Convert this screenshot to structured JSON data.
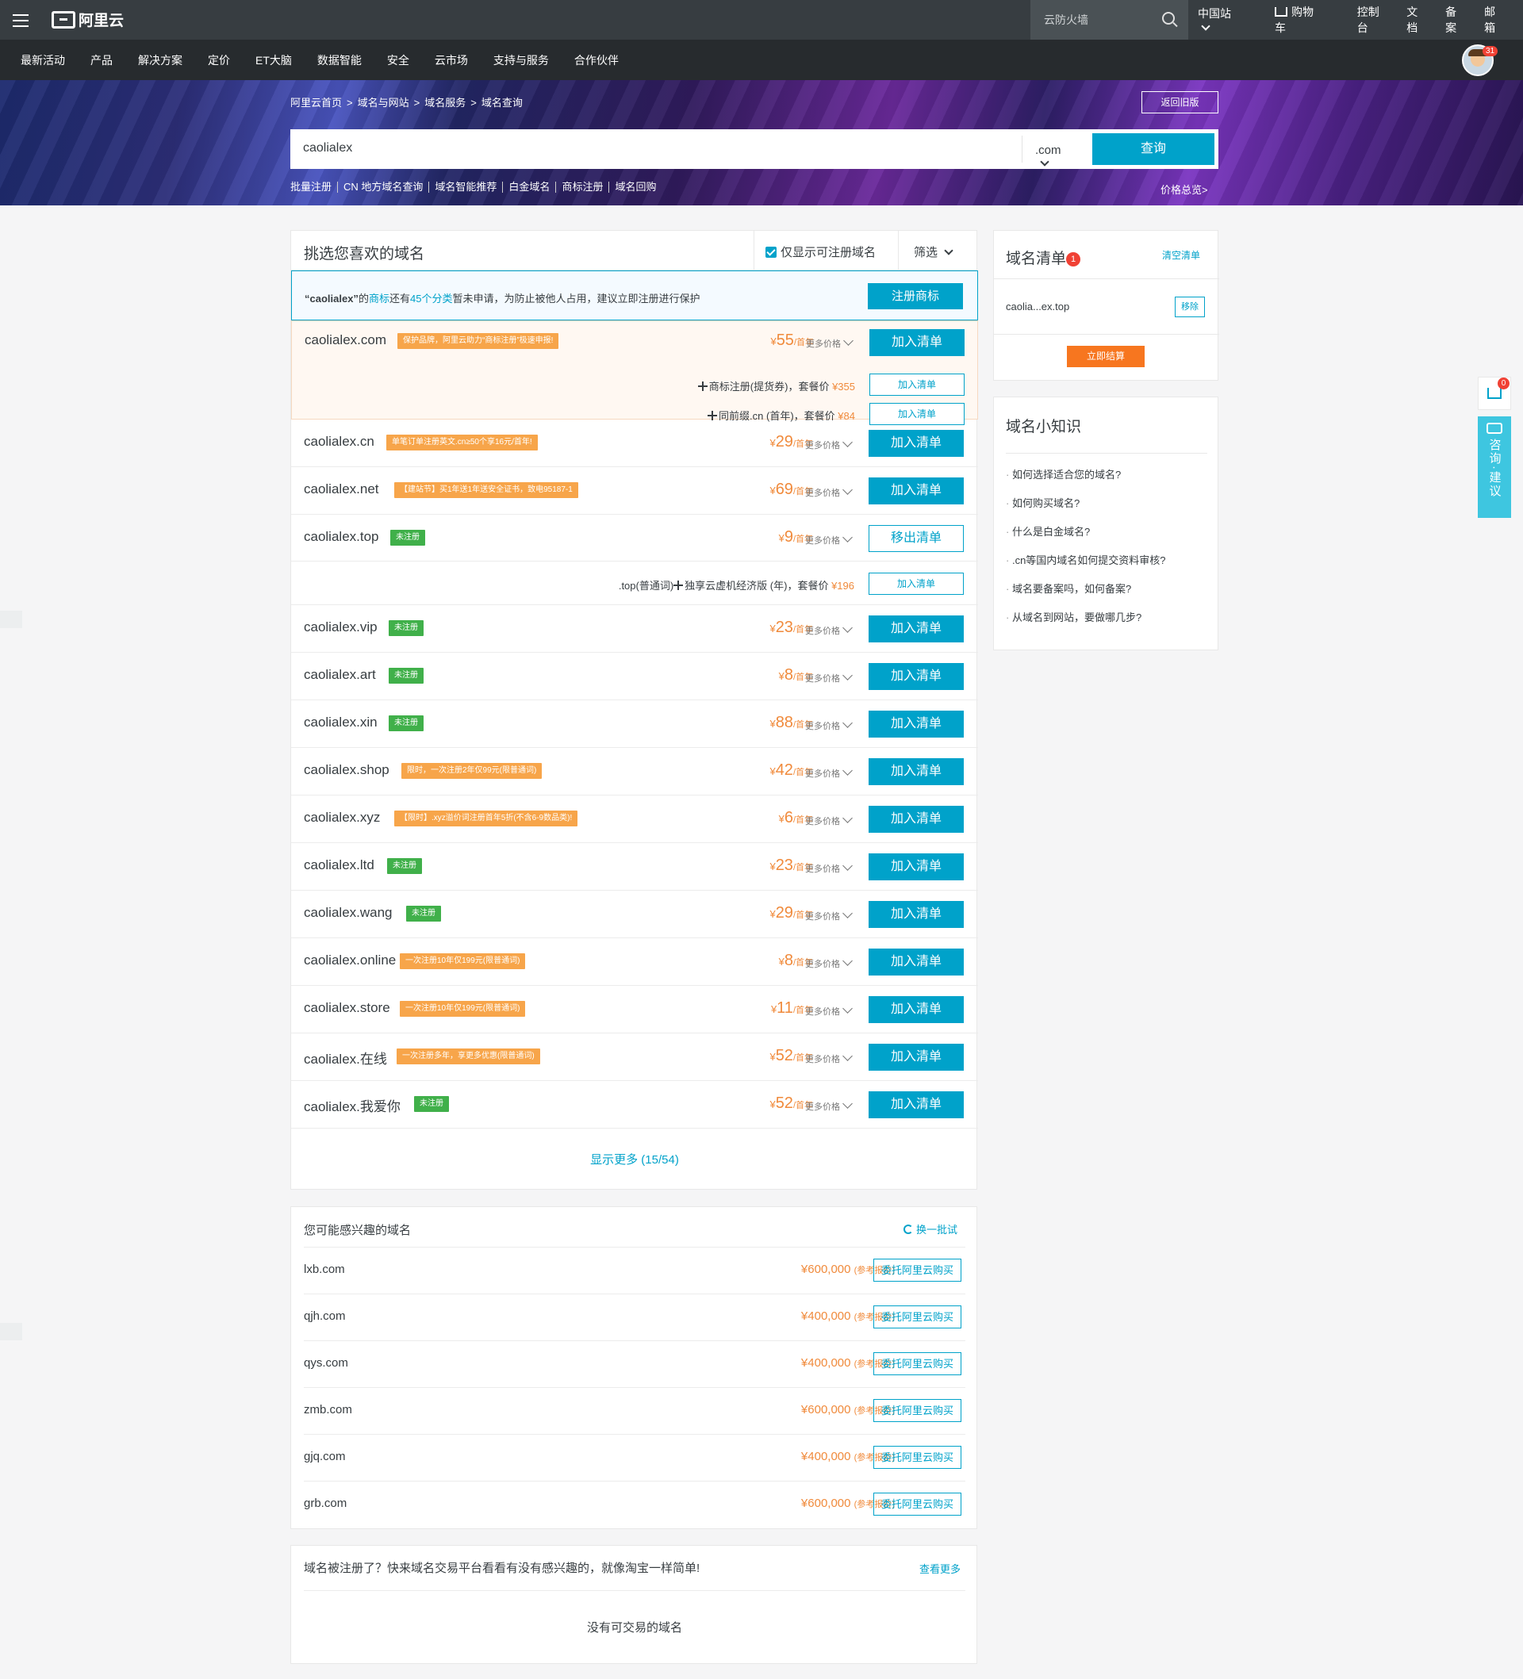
{
  "header": {
    "brand": "阿里云",
    "search_placeholder": "云防火墙",
    "site": "中国站",
    "cart": "购物车",
    "console": "控制台",
    "docs": "文档",
    "beian": "备案",
    "mail": "邮箱",
    "avatar_badge": "31"
  },
  "nav": [
    "最新活动",
    "产品",
    "解决方案",
    "定价",
    "ET大脑",
    "数据智能",
    "安全",
    "云市场",
    "支持与服务",
    "合作伙伴"
  ],
  "breadcrumb": [
    "阿里云首页",
    ">",
    "域名与网站",
    ">",
    "域名服务",
    ">",
    "域名查询"
  ],
  "old_version": "返回旧版",
  "search": {
    "query": "caolialex",
    "suffix": ".com",
    "button": "查询"
  },
  "quicklinks": [
    "批量注册",
    "CN 地方域名查询",
    "域名智能推荐",
    "白金域名",
    "商标注册",
    "域名回购"
  ],
  "price_overview": "价格总览>",
  "main": {
    "title": "挑选您喜欢的域名",
    "only_available": "仅显示可注册域名",
    "filter": "筛选",
    "notice": {
      "name": "“caolialex”",
      "p1": "的",
      "link1": "商标",
      "p2": "还有",
      "link2": "45个分类",
      "p3": "暂未申请，为防止被他人占用，建议立即注册进行保护",
      "button": "注册商标"
    },
    "rows": [
      {
        "name": "caolialex.com",
        "tag": "保护品牌，阿里云助力“商标注册”极速申报!",
        "price": "55",
        "button": "加入清单"
      },
      {
        "name": "caolialex.cn",
        "tag": "单笔订单注册英文.cn≥50个享16元/首年!",
        "price": "29",
        "button": "加入清单"
      },
      {
        "name": "caolialex.net",
        "tag": "【建站节】买1年送1年送安全证书，致电95187-1",
        "price": "69",
        "button": "加入清单"
      },
      {
        "name": "caolialex.top",
        "tag": "未注册",
        "price": "9",
        "button": "移出清单"
      },
      {
        "name": "caolialex.vip",
        "tag": "未注册",
        "price": "23",
        "button": "加入清单"
      },
      {
        "name": "caolialex.art",
        "tag": "未注册",
        "price": "8",
        "button": "加入清单"
      },
      {
        "name": "caolialex.xin",
        "tag": "未注册",
        "price": "88",
        "button": "加入清单"
      },
      {
        "name": "caolialex.shop",
        "tag": "限时，一次注册2年仅99元(限普通词)",
        "price": "42",
        "button": "加入清单"
      },
      {
        "name": "caolialex.xyz",
        "tag": "【限时】.xyz溢价词注册首年5折(不含6-9数品类)!",
        "price": "6",
        "button": "加入清单"
      },
      {
        "name": "caolialex.ltd",
        "tag": "未注册",
        "price": "23",
        "button": "加入清单"
      },
      {
        "name": "caolialex.wang",
        "tag": "未注册",
        "price": "29",
        "button": "加入清单"
      },
      {
        "name": "caolialex.online",
        "tag": "一次注册10年仅199元(限普通词)",
        "price": "8",
        "button": "加入清单"
      },
      {
        "name": "caolialex.store",
        "tag": "一次注册10年仅199元(限普通词)",
        "price": "11",
        "button": "加入清单"
      },
      {
        "name": "caolialex.在线",
        "tag": "一次注册多年，享更多优惠(限普通词)",
        "price": "52",
        "button": "加入清单"
      },
      {
        "name": "caolialex.我爱你",
        "tag": "未注册",
        "price": "52",
        "button": "加入清单"
      }
    ],
    "currency": "¥",
    "unit": "/首年",
    "more_price": "更多价格",
    "subs": [
      {
        "text": "商标注册(提货券)，套餐价",
        "price": "¥355",
        "button": "加入清单"
      },
      {
        "text": "同前缀.cn (首年)，套餐价",
        "price": "¥84",
        "button": "加入清单"
      },
      {
        "text": ".top(普通词)",
        "text2": "独享云虚机经济版 (年)，套餐价",
        "price": "¥196",
        "button": "加入清单"
      }
    ],
    "show_more": "显示更多 (15/54)"
  },
  "sidebar": {
    "title": "域名清单",
    "badge": "1",
    "clear": "清空清单",
    "item": "caolia...ex.top",
    "remove": "移除",
    "checkout": "立即结算"
  },
  "knowledge": {
    "title": "域名小知识",
    "items": [
      "如何选择适合您的域名?",
      "如何购买域名?",
      "什么是白金域名?",
      ".cn等国内域名如何提交资料审核?",
      "域名要备案吗，如何备案?",
      "从域名到网站，要做哪几步?"
    ]
  },
  "float": {
    "cart_badge": "0",
    "consult": "咨询·建议"
  },
  "recommend": {
    "title": "您可能感兴趣的域名",
    "swap": "换一批试",
    "note": "(参考报价)",
    "button": "委托阿里云购买",
    "rows": [
      {
        "name": "lxb.com",
        "price": "¥600,000"
      },
      {
        "name": "qjh.com",
        "price": "¥400,000"
      },
      {
        "name": "qys.com",
        "price": "¥400,000"
      },
      {
        "name": "zmb.com",
        "price": "¥600,000"
      },
      {
        "name": "gjq.com",
        "price": "¥400,000"
      },
      {
        "name": "grb.com",
        "price": "¥600,000"
      }
    ]
  },
  "trade": {
    "title": "域名被注册了？快来域名交易平台看看有没有感兴趣的，就像淘宝一样简单!",
    "more": "查看更多",
    "empty": "没有可交易的域名"
  }
}
